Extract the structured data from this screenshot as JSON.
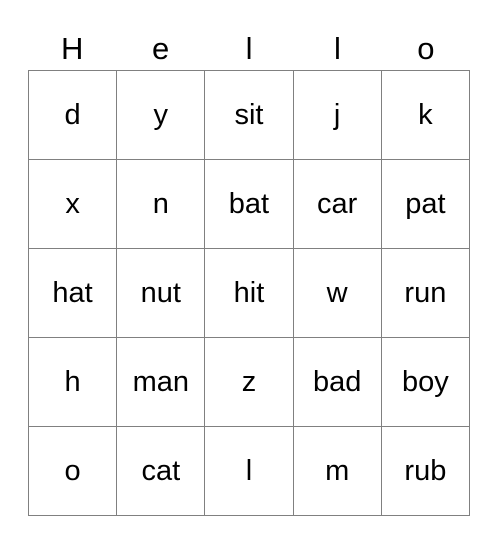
{
  "card": {
    "header_letters": [
      "H",
      "e",
      "l",
      "l",
      "o"
    ],
    "grid": [
      [
        "d",
        "y",
        "sit",
        "j",
        "k"
      ],
      [
        "x",
        "n",
        "bat",
        "car",
        "pat"
      ],
      [
        "hat",
        "nut",
        "hit",
        "w",
        "run"
      ],
      [
        "h",
        "man",
        "z",
        "bad",
        "boy"
      ],
      [
        "o",
        "cat",
        "l",
        "m",
        "rub"
      ]
    ],
    "colors": {
      "background": "#ffffff",
      "border": "#808080",
      "text": "#000000"
    }
  }
}
